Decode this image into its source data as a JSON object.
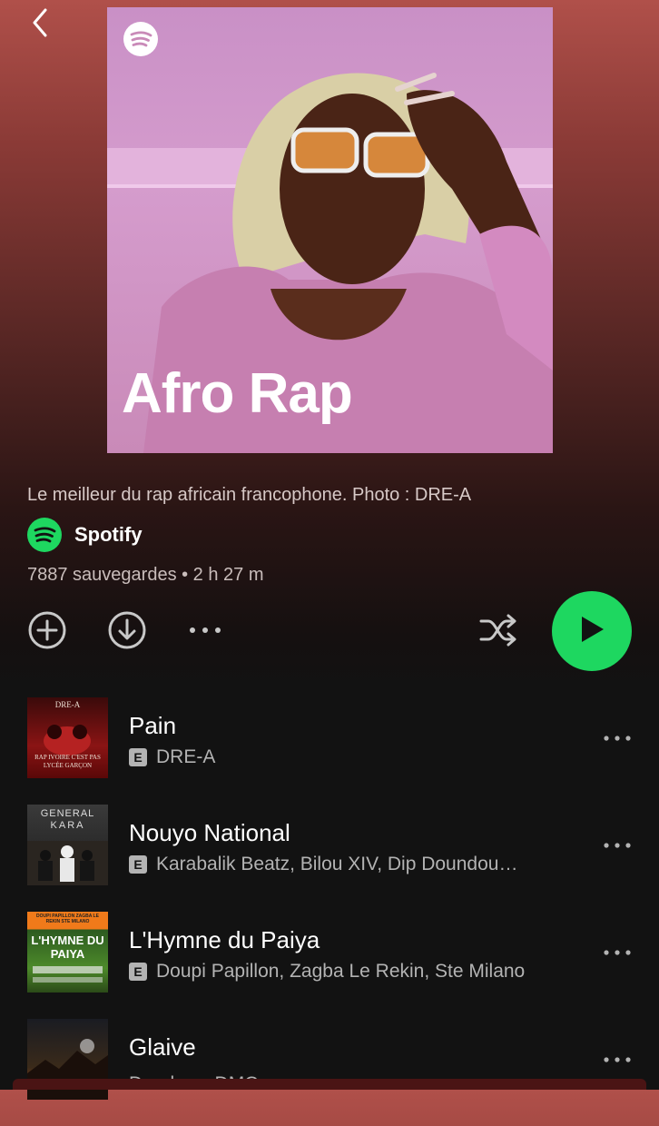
{
  "nav": {
    "back_icon": "chevron-left-icon"
  },
  "playlist": {
    "cover_title": "Afro Rap",
    "description": "Le meilleur du rap africain francophone. Photo : DRE-A",
    "owner": "Spotify",
    "meta": "7887 sauvegardes • 2 h 27 m"
  },
  "controls": {
    "add_icon": "plus-circle-icon",
    "download_icon": "download-circle-icon",
    "more_icon": "more-horizontal-icon",
    "shuffle_icon": "shuffle-icon",
    "play_icon": "play-icon"
  },
  "colors": {
    "accent": "#1ed760",
    "background": "#121212",
    "header_tint": "#b0504a",
    "secondary_text": "#b3b3b3"
  },
  "tracks": [
    {
      "title": "Pain",
      "explicit": "E",
      "artists": "DRE-A",
      "thumb_text_top": "DRE-A",
      "thumb_text_bottom": "RAP IVOIRE C'EST PAS LYCÉE GARÇON"
    },
    {
      "title": "Nouyo National",
      "explicit": "E",
      "artists": "Karabalik Beatz, Bilou XIV, Dip Doundou…",
      "thumb_text_top": "GENERAL",
      "thumb_text_bottom": "KARA"
    },
    {
      "title": "L'Hymne du Paiya",
      "explicit": "E",
      "artists": "Doupi Papillon, Zagba Le Rekin, Ste Milano",
      "thumb_text_top": "DOUPI PAPILLON ZAGBA LE REKIN STE MILANO",
      "thumb_text_bottom": "L'HYMNE DU PAIYA"
    },
    {
      "title": "Glaive",
      "explicit": "",
      "artists": "Doudou…DMC",
      "thumb_text_top": "",
      "thumb_text_bottom": ""
    }
  ]
}
